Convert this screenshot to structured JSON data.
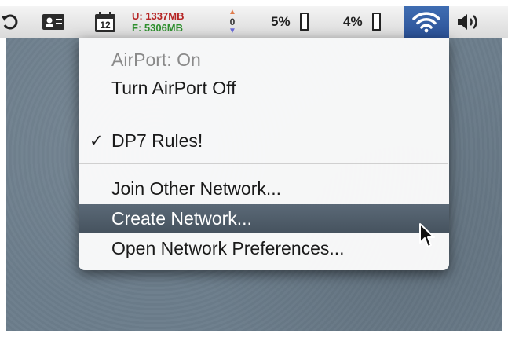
{
  "menubar": {
    "calendar_day": "12",
    "memory_used": "U: 1337MB",
    "memory_free": "F: 5306MB",
    "network_count": "0",
    "cpu1_percent": "5%",
    "cpu1_level": 0.05,
    "cpu2_percent": "4%",
    "cpu2_level": 0.04
  },
  "airport_menu": {
    "status": "AirPort: On",
    "toggle": "Turn AirPort Off",
    "network_check": "✓",
    "network": "DP7 Rules!",
    "join": "Join Other Network...",
    "create": "Create Network...",
    "preferences": "Open Network Preferences..."
  },
  "colors": {
    "menubar": "#e6e6e6",
    "highlight": "#4f5d6b",
    "wifi_active": "#3160a8",
    "memory_used": "#b52424",
    "memory_free": "#2e8f2e"
  }
}
